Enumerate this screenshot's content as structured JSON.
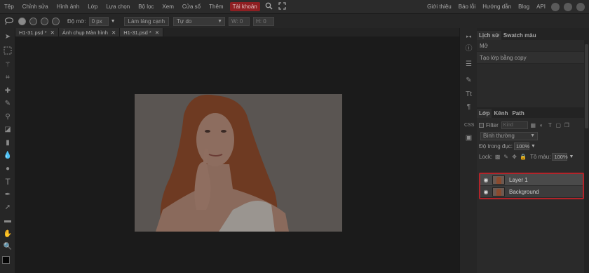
{
  "menu": {
    "items": [
      "Tệp",
      "Chỉnh sửa",
      "Hình ảnh",
      "Lớp",
      "Lựa chọn",
      "Bộ lọc",
      "Xem",
      "Cửa sổ",
      "Thêm"
    ],
    "account": "Tài khoản",
    "right_links": [
      "Giới thiệu",
      "Báo lỗi",
      "Hướng dẫn",
      "Blog",
      "API"
    ],
    "accent_color": "#8e1f22"
  },
  "options": {
    "feather_label": "Độ mờ:",
    "feather_value": "0 px",
    "refine_button": "Làm láng cạnh",
    "mode_select": "Tự do",
    "w_value": "0",
    "h_value": "0"
  },
  "tabs": [
    {
      "label": "H1-31.psd *",
      "close": "✕"
    },
    {
      "label": "Ảnh chụp Màn hình",
      "close": "✕"
    },
    {
      "label": "H1-31.psd *",
      "close": "✕"
    }
  ],
  "history": {
    "tabs": [
      "Lịch sử",
      "Swatch màu"
    ],
    "entries": [
      "Mở",
      "Tạo lớp bằng copy"
    ]
  },
  "layers": {
    "tabs": [
      "Lớp",
      "Kênh",
      "Path"
    ],
    "filter_label": "Filter",
    "kind_placeholder": "Kind",
    "blend_mode": "Bình thường",
    "opacity_label": "Độ trong đục:",
    "opacity_value": "100%",
    "lock_label": "Lock:",
    "fill_label": "Tô màu:",
    "fill_value": "100%",
    "items": [
      {
        "name": "Layer 1"
      },
      {
        "name": "Background"
      }
    ],
    "highlight_color": "#b3242a"
  }
}
